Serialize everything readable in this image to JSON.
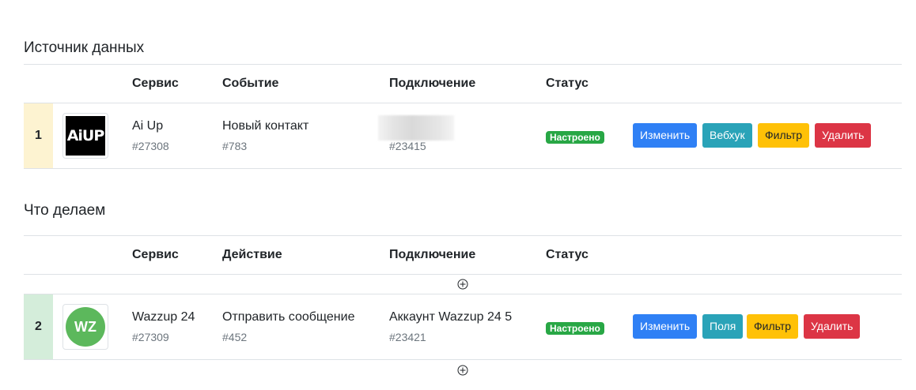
{
  "source_section": {
    "title": "Источник данных",
    "headers": {
      "service": "Сервис",
      "event": "Событие",
      "connection": "Подключение",
      "status": "Статус"
    },
    "row": {
      "number": "1",
      "logo_text": "AiUP",
      "service_name": "Ai Up",
      "service_id": "#27308",
      "event_name": "Новый контакт",
      "event_id": "#783",
      "connection_id": "#23415",
      "status": "Настроено",
      "buttons": {
        "edit": "Изменить",
        "webhook": "Вебхук",
        "filter": "Фильтр",
        "delete": "Удалить"
      }
    },
    "number_bg": "#fdf3d1"
  },
  "action_section": {
    "title": "Что делаем",
    "headers": {
      "service": "Сервис",
      "action": "Действие",
      "connection": "Подключение",
      "status": "Статус"
    },
    "row": {
      "number": "2",
      "logo_text": "WZ",
      "service_name": "Wazzup 24",
      "service_id": "#27309",
      "action_name": "Отправить сообщение",
      "action_id": "#452",
      "connection_name": "Аккаунт Wazzup 24 5",
      "connection_id": "#23421",
      "status": "Настроено",
      "buttons": {
        "edit": "Изменить",
        "fields": "Поля",
        "filter": "Фильтр",
        "delete": "Удалить"
      }
    },
    "number_bg": "#d4edda"
  },
  "icons": [
    "add-step-icon"
  ]
}
